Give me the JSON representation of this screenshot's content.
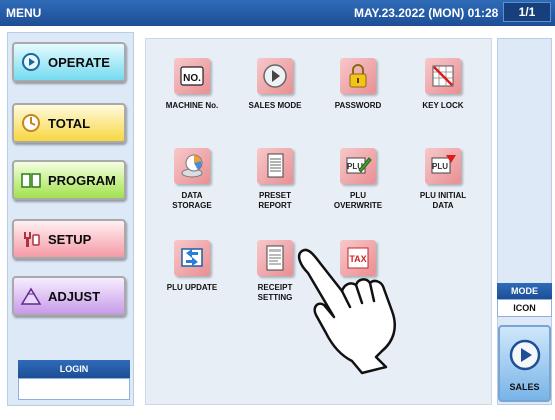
{
  "header": {
    "title": "MENU",
    "datetime": "MAY.23.2022 (MON) 01:28",
    "page": "1/1"
  },
  "sidebar": {
    "buttons": [
      {
        "label": "OPERATE",
        "icon": "play-circle-icon"
      },
      {
        "label": "TOTAL",
        "icon": "clock-icon"
      },
      {
        "label": "PROGRAM",
        "icon": "book-icon"
      },
      {
        "label": "SETUP",
        "icon": "wrench-icon"
      },
      {
        "label": "ADJUST",
        "icon": "scale-icon"
      }
    ],
    "login_label": "LOGIN",
    "login_value": ""
  },
  "items": [
    {
      "label": "MACHINE No.",
      "icon": "machine-number-icon"
    },
    {
      "label": "SALES MODE",
      "icon": "sales-mode-icon"
    },
    {
      "label": "PASSWORD",
      "icon": "padlock-icon"
    },
    {
      "label": "KEY LOCK",
      "icon": "key-lock-icon"
    },
    {
      "label": "DATA\nSTORAGE",
      "icon": "data-storage-icon"
    },
    {
      "label": "PRESET\nREPORT",
      "icon": "preset-report-icon"
    },
    {
      "label": "PLU\nOVERWRITE",
      "icon": "plu-overwrite-icon"
    },
    {
      "label": "PLU INITIAL\nDATA",
      "icon": "plu-initial-data-icon"
    },
    {
      "label": "PLU UPDATE",
      "icon": "plu-update-icon"
    },
    {
      "label": "RECEIPT\nSETTING",
      "icon": "receipt-setting-icon"
    },
    {
      "label": "",
      "icon": "tax-icon"
    }
  ],
  "right": {
    "mode_label": "MODE",
    "mode_value": "ICON",
    "sales_label": "SALES",
    "sales_icon": "play-circle-icon"
  },
  "colors": {
    "header_blue": "#1d4e96",
    "panel_bg": "#e8eef6",
    "icon_tile": "#e98f93"
  }
}
